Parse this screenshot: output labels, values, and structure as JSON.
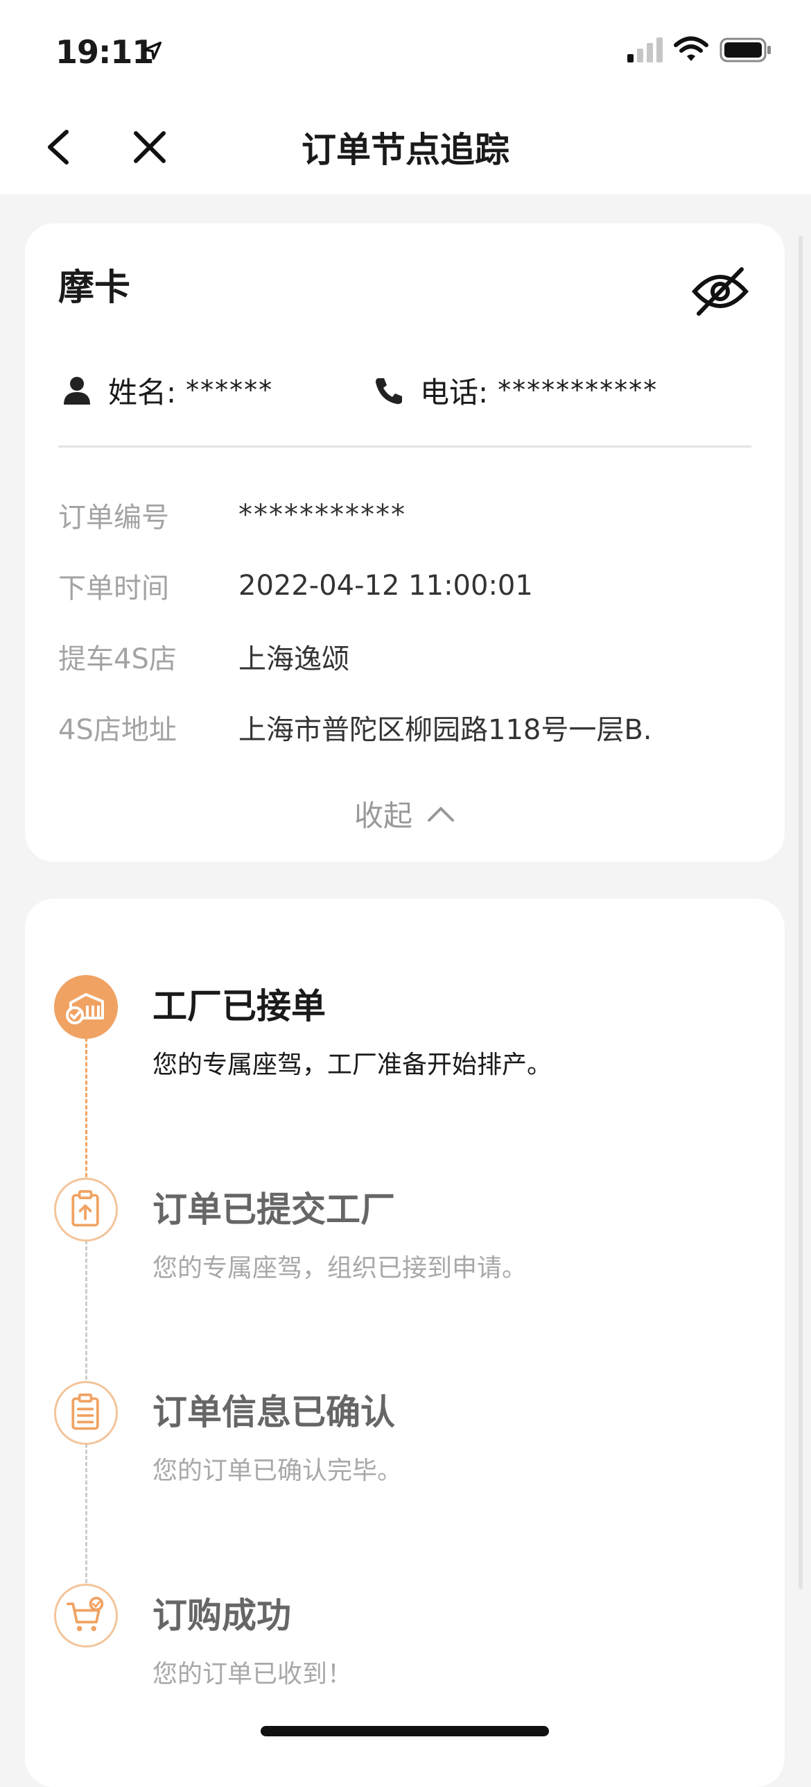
{
  "status_bar": {
    "time": "19:11"
  },
  "nav": {
    "title": "订单节点追踪",
    "back_icon": "chevron-left-icon",
    "close_icon": "close-icon"
  },
  "info_card": {
    "model": "摩卡",
    "name_label": "姓名:",
    "name_value": "******",
    "phone_label": "电话:",
    "phone_value": "***********",
    "rows": [
      {
        "label": "订单编号",
        "value": "***********"
      },
      {
        "label": "下单时间",
        "value": "2022-04-12 11:00:01"
      },
      {
        "label": "提车4S店",
        "value": "上海逸颂"
      },
      {
        "label": "4S店地址",
        "value": "上海市普陀区柳园路118号一层B."
      }
    ],
    "collapse_label": "收起"
  },
  "timeline": [
    {
      "title": "工厂已接单",
      "desc": "您的专属座驾，工厂准备开始排产。",
      "active": true,
      "icon": "factory-icon"
    },
    {
      "title": "订单已提交工厂",
      "desc": "您的专属座驾，组织已接到申请。",
      "active": false,
      "icon": "clipboard-upload-icon"
    },
    {
      "title": "订单信息已确认",
      "desc": "您的订单已确认完毕。",
      "active": false,
      "icon": "clipboard-list-icon"
    },
    {
      "title": "订购成功",
      "desc": "您的订单已收到！",
      "active": false,
      "icon": "cart-check-icon"
    }
  ],
  "colors": {
    "accent": "#f0a262",
    "accent_light": "#f3c49a",
    "background": "#f4f4f5"
  }
}
